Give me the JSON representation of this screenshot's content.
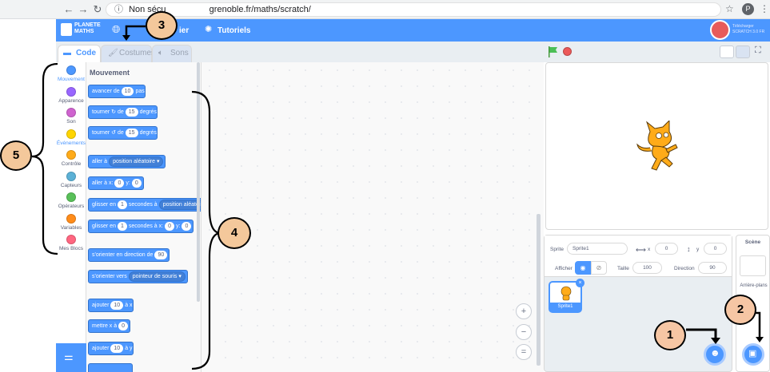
{
  "browser": {
    "back": "←",
    "forward": "→",
    "reload": "↻",
    "security_text": "Non sécu",
    "url": "grenoble.fr/maths/scratch/",
    "profile_letter": "P"
  },
  "menubar": {
    "logo_line1": "PLANETE",
    "logo_line2": "MATHS",
    "file_partial": "ier",
    "tutorials": "Tutoriels",
    "download_line1": "Télécharger",
    "download_line2": "SCRATCH 3.0 FR"
  },
  "tabs": {
    "code": "Code",
    "costumes": "Costumes",
    "sounds": "Sons"
  },
  "categories": [
    {
      "label": "Mouvement",
      "color": "#4c97ff"
    },
    {
      "label": "Apparence",
      "color": "#9966ff"
    },
    {
      "label": "Son",
      "color": "#cf63cf"
    },
    {
      "label": "Événements",
      "color": "#ffd500"
    },
    {
      "label": "Contrôle",
      "color": "#ffab19"
    },
    {
      "label": "Capteurs",
      "color": "#5cb1d6"
    },
    {
      "label": "Opérateurs",
      "color": "#59c059"
    },
    {
      "label": "Variables",
      "color": "#ff8c1a"
    },
    {
      "label": "Mes Blocs",
      "color": "#ff6680"
    }
  ],
  "palette": {
    "title": "Mouvement",
    "blocks": {
      "move": {
        "pre": "avancer de",
        "val": "10",
        "post": "pas"
      },
      "turn_right": {
        "pre": "tourner",
        "icon": "↻",
        "mid": "de",
        "val": "15",
        "post": "degrés"
      },
      "turn_left": {
        "pre": "tourner",
        "icon": "↺",
        "mid": "de",
        "val": "15",
        "post": "degrés"
      },
      "goto": {
        "pre": "aller à",
        "dd": "position aléatoire ▾"
      },
      "goto_xy": {
        "pre": "aller à x:",
        "x": "0",
        "mid": "y:",
        "y": "0"
      },
      "glide_to": {
        "pre": "glisser en",
        "val": "1",
        "mid": "secondes à",
        "dd": "position aléatoire"
      },
      "glide_xy": {
        "pre": "glisser en",
        "val": "1",
        "mid": "secondes à x:",
        "x": "0",
        "mid2": "y:",
        "y": "0"
      },
      "point_dir": {
        "pre": "s'orienter en direction de",
        "val": "90"
      },
      "point_towards": {
        "pre": "s'orienter vers",
        "dd": "pointeur de souris ▾"
      },
      "change_x": {
        "pre": "ajouter",
        "val": "10",
        "post": "à x"
      },
      "set_x": {
        "pre": "mettre x à",
        "val": "0"
      },
      "change_y": {
        "pre": "ajouter",
        "val": "10",
        "post": "à y"
      }
    }
  },
  "zoom": {
    "in": "+",
    "out": "−",
    "reset": "="
  },
  "sprite": {
    "label": "Sprite",
    "name": "Sprite1",
    "x_label": "x",
    "x_value": "0",
    "y_label": "y",
    "y_value": "0",
    "show_label": "Afficher",
    "size_label": "Taille",
    "size_value": "100",
    "direction_label": "Direction",
    "direction_value": "90",
    "thumb_name": "Sprite1"
  },
  "stage_panel": {
    "title": "Scène",
    "backdrops_label": "Arrière-plans"
  },
  "callouts": [
    "1",
    "2",
    "3",
    "4",
    "5"
  ]
}
